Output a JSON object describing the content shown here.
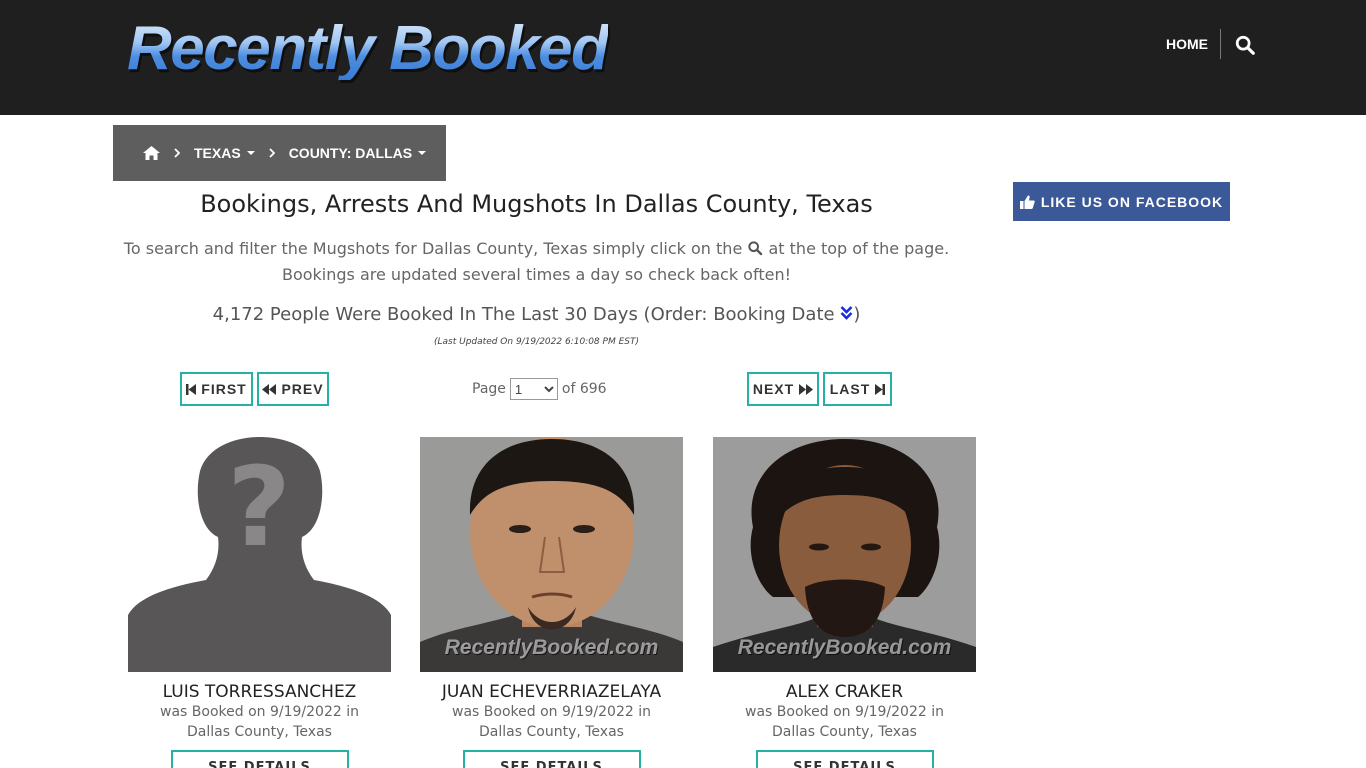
{
  "header": {
    "logo_text": "Recently Booked",
    "nav_home": "HOME",
    "search_icon": "search-icon"
  },
  "breadcrumb": {
    "home_icon": "home-icon",
    "state": "TEXAS",
    "county": "COUNTY: DALLAS"
  },
  "main": {
    "title": "Bookings, Arrests And Mugshots In Dallas County, Texas",
    "intro_before": "To search and filter the Mugshots for Dallas County, Texas simply click on the",
    "intro_after": "at the top of the page. Bookings are updated several times a day so check back often!",
    "summary_text": "4,172 People Were Booked In The Last 30 Days (Order: Booking Date",
    "summary_close": ")",
    "last_updated": "(Last Updated On 9/19/2022 6:10:08 PM EST)"
  },
  "pagination": {
    "first": "FIRST",
    "prev": "PREV",
    "page_label": "Page",
    "page_value": "1",
    "of_label": "of 696",
    "next": "NEXT",
    "last": "LAST"
  },
  "bookings": [
    {
      "name": "LUIS TORRESSANCHEZ",
      "line1": "was Booked on 9/19/2022 in",
      "line2": "Dallas County, Texas",
      "button": "SEE DETAILS",
      "photo": "silhouette-placeholder",
      "watermark": ""
    },
    {
      "name": "JUAN ECHEVERRIAZELAYA",
      "line1": "was Booked on 9/19/2022 in",
      "line2": "Dallas County, Texas",
      "button": "SEE DETAILS",
      "photo": "mugshot",
      "watermark": "RecentlyBooked.com"
    },
    {
      "name": "ALEX CRAKER",
      "line1": "was Booked on 9/19/2022 in",
      "line2": "Dallas County, Texas",
      "button": "SEE DETAILS",
      "photo": "mugshot",
      "watermark": "RecentlyBooked.com"
    }
  ],
  "sidebar": {
    "facebook_label": "LIKE US ON FACEBOOK"
  },
  "colors": {
    "header_bg": "#1f1f1f",
    "breadcrumb_bg": "#5e5e5e",
    "accent_teal": "#25b1a5",
    "facebook_blue": "#3b5998",
    "sort_icon_blue": "#1a2fd6"
  }
}
